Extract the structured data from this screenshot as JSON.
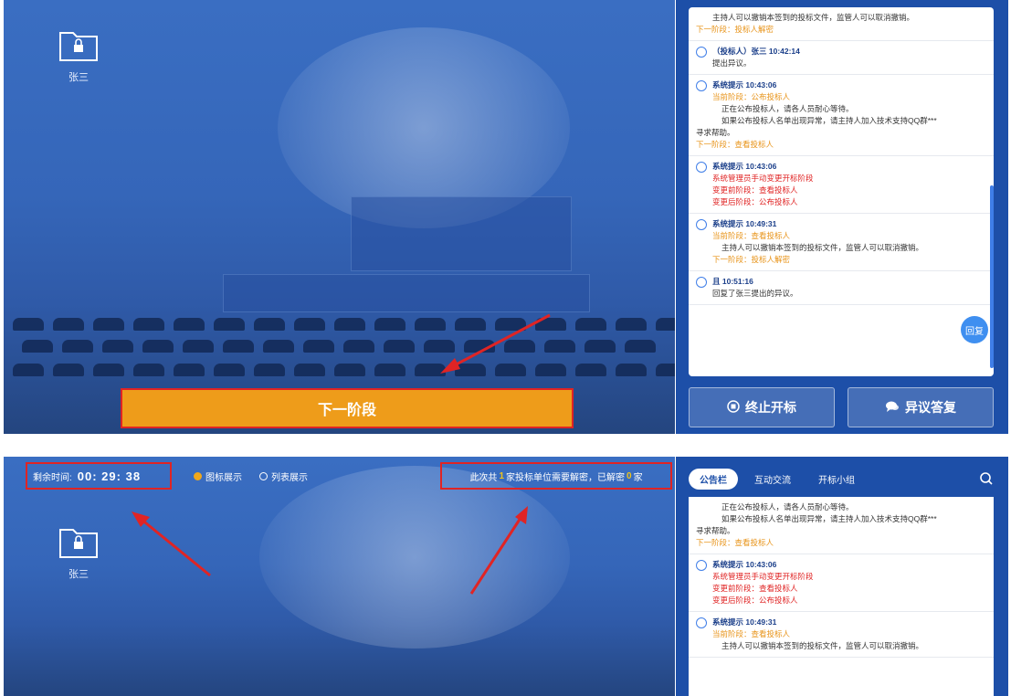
{
  "colors": {
    "accent": "#1d4fa8",
    "highlight_border": "#e02424",
    "next_button": "#ee9c1a",
    "warning": "#e8941a",
    "alert": "#e02424"
  },
  "screenshot_top": {
    "folder": {
      "label": "张三",
      "icon": "lock-folder-icon"
    },
    "next_stage_button": "下一阶段",
    "messages": [
      {
        "lines": [
          "主持人可以撤销本签到的投标文件，监管人可以取消撤销。"
        ],
        "next": "下一阶段：投标人解密"
      },
      {
        "head": "（投标人）张三 10:42:14",
        "body": [
          "提出异议。"
        ]
      },
      {
        "head": "系统提示 10:43:06",
        "stage": "当前阶段：公布投标人",
        "body": [
          "正在公布投标人，请各人员耐心等待。",
          "如果公布投标人名单出现异常，请主持人加入技术支持QQ群***",
          "寻求帮助。"
        ],
        "next": "下一阶段：查看投标人"
      },
      {
        "head": "系统提示 10:43:06",
        "red": [
          "系统管理员手动变更开标阶段",
          "变更前阶段：查看投标人",
          "变更后阶段：公布投标人"
        ]
      },
      {
        "head": "系统提示 10:49:31",
        "stage": "当前阶段：查看投标人",
        "body": [
          "主持人可以撤销本签到的投标文件，监管人可以取消撤销。"
        ],
        "next": "下一阶段：投标人解密"
      },
      {
        "head": "且 10:51:16",
        "body": [
          "回复了张三提出的异议。"
        ]
      }
    ],
    "reply_button": "回复",
    "stop_button": "终止开标",
    "objection_button": "异议答复"
  },
  "screenshot_bottom": {
    "timer_label": "剩余时间:",
    "timer_value": "00: 29: 38",
    "view_options": [
      {
        "label": "图标展示",
        "selected": true
      },
      {
        "label": "列表展示",
        "selected": false
      }
    ],
    "notice": {
      "prefix": "此次共",
      "total": "1",
      "middle": "家投标单位需要解密，已解密",
      "done": "0",
      "suffix": "家"
    },
    "tabs": [
      "公告栏",
      "互动交流",
      "开标小组"
    ],
    "folder": {
      "label": "张三",
      "icon": "lock-folder-icon"
    },
    "messages": [
      {
        "lines": [
          "正在公布投标人，请各人员耐心等待。",
          "如果公布投标人名单出现异常，请主持人加入技术支持QQ群***",
          "寻求帮助。"
        ],
        "next": "下一阶段：查看投标人"
      },
      {
        "head": "系统提示 10:43:06",
        "red": [
          "系统管理员手动变更开标阶段",
          "变更前阶段：查看投标人",
          "变更后阶段：公布投标人"
        ]
      },
      {
        "head": "系统提示 10:49:31",
        "stage": "当前阶段：查看投标人",
        "body": [
          "主持人可以撤销本签到的投标文件，监管人可以取消撤销。"
        ]
      }
    ]
  }
}
